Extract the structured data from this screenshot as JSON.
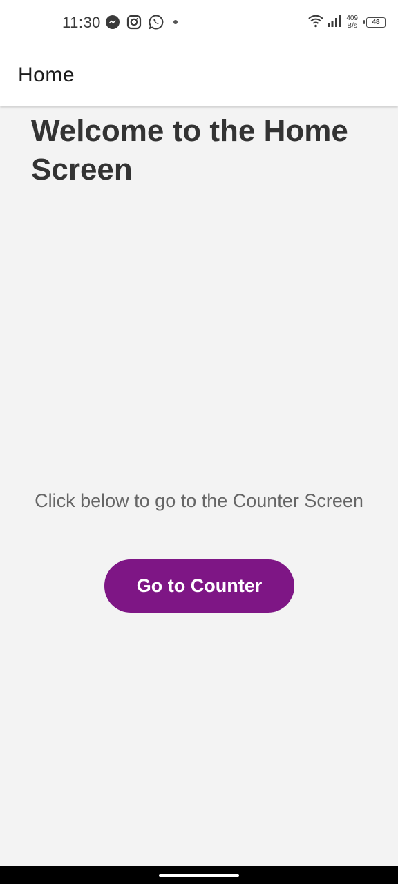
{
  "status_bar": {
    "time": "11:30",
    "notification_icons": [
      "messenger-icon",
      "instagram-icon",
      "whatsapp-icon",
      "dot-icon"
    ],
    "net_speed_value": "409",
    "net_speed_unit": "B/s",
    "battery": "48"
  },
  "app_bar": {
    "title": "Home"
  },
  "main": {
    "heading": "Welcome to the Home Screen",
    "instruction": "Click below to go to the Counter Screen",
    "button_label": "Go to Counter"
  },
  "colors": {
    "accent": "#7e1685",
    "background": "#f3f3f3",
    "heading": "#333333",
    "instruction": "#666666"
  }
}
